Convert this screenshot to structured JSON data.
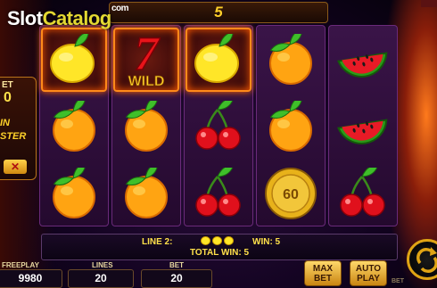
{
  "logo": {
    "slot": "Slot",
    "catalog": "Catalog",
    "com": "com"
  },
  "top_counter": "5",
  "left_panel": {
    "bet_label": "ET",
    "bet_value": "0",
    "feature_line1": "IN",
    "feature_line2": "STER",
    "close_symbol": "✕"
  },
  "reels": [
    [
      "lemon",
      "orange",
      "orange"
    ],
    [
      "wild-seven",
      "orange",
      "orange"
    ],
    [
      "lemon",
      "cherry",
      "cherry"
    ],
    [
      "orange",
      "orange",
      "coin"
    ],
    [
      "watermelon",
      "watermelon",
      "cherry"
    ]
  ],
  "winning_cells": [
    [
      0,
      0
    ],
    [
      1,
      0
    ],
    [
      2,
      0
    ]
  ],
  "wild_label": "WILD",
  "coin_value": "60",
  "win_info": {
    "line_label": "LINE 2:",
    "win_label": "WIN: 5",
    "total_win": "TOTAL WIN: 5",
    "line_symbol_count": 3
  },
  "bottom": {
    "freeplay_label": "FREEPLAY",
    "freeplay_value": "9980",
    "lines_label": "LINES",
    "lines_value": "20",
    "bet_label": "BET",
    "bet_value": "20",
    "max_bet_line1": "MAX",
    "max_bet_line2": "BET",
    "auto_play_line1": "AUTO",
    "auto_play_line2": "PLAY",
    "bet_side_label": "BET"
  },
  "colors": {
    "accent": "#ffd02a",
    "reel_bg": "#2a0c36",
    "win_border": "#ff8a1a"
  }
}
